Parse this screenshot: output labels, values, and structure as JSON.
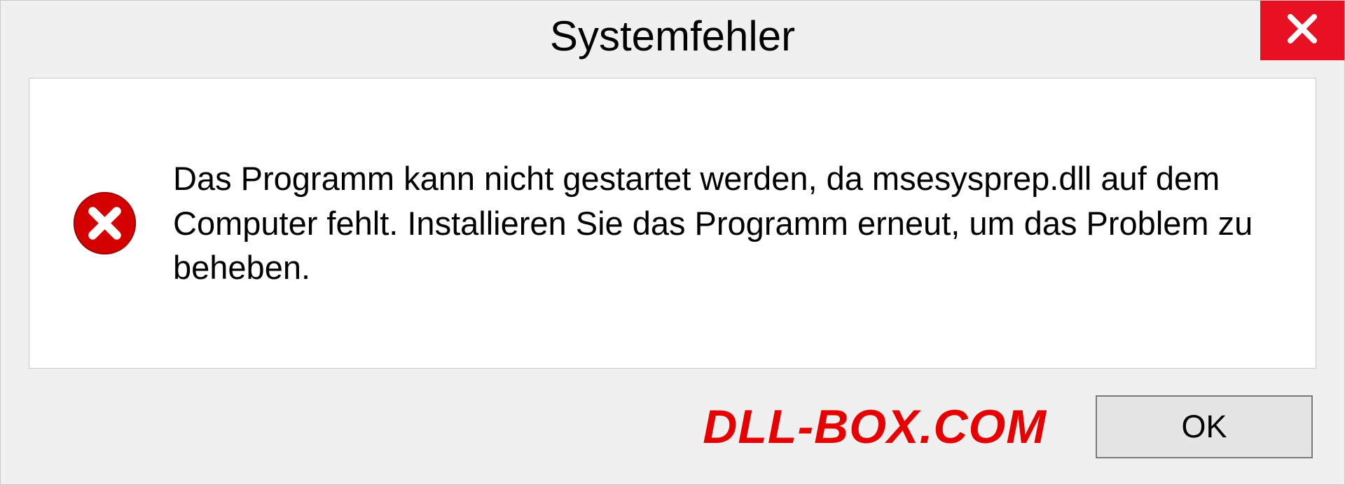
{
  "dialog": {
    "title": "Systemfehler",
    "message": "Das Programm kann nicht gestartet werden, da msesysprep.dll auf dem Computer fehlt. Installieren Sie das Programm erneut, um das Problem zu beheben.",
    "ok_label": "OK"
  },
  "watermark": "DLL-BOX.COM",
  "colors": {
    "close_bg": "#e81123",
    "error_red": "#d40000",
    "watermark_red": "#e60000"
  }
}
